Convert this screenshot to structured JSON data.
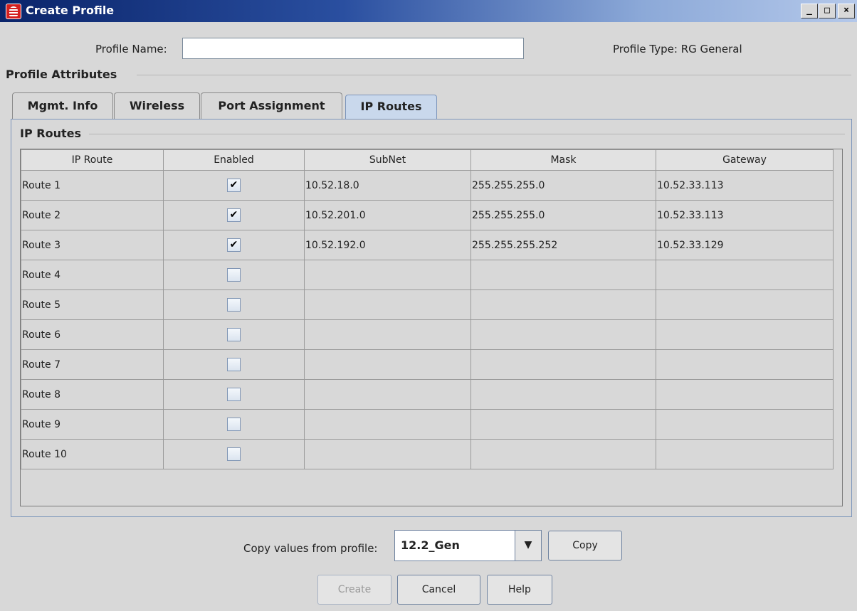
{
  "window": {
    "title": "Create Profile",
    "controls": {
      "minimize": "_",
      "maximize": "□",
      "close": "×"
    }
  },
  "profile": {
    "name_label": "Profile Name:",
    "name_value": "",
    "type_label": "Profile Type:",
    "type_value": "RG General"
  },
  "attributes": {
    "section_title": "Profile Attributes",
    "tabs": [
      {
        "label": "Mgmt. Info",
        "active": false
      },
      {
        "label": "Wireless",
        "active": false
      },
      {
        "label": "Port Assignment",
        "active": false
      },
      {
        "label": "IP Routes",
        "active": true
      }
    ]
  },
  "ip_routes": {
    "section_title": "IP Routes",
    "columns": [
      "IP Route",
      "Enabled",
      "SubNet",
      "Mask",
      "Gateway"
    ],
    "rows": [
      {
        "route": "Route 1",
        "enabled": true,
        "subnet": "10.52.18.0",
        "mask": "255.255.255.0",
        "gateway": "10.52.33.113"
      },
      {
        "route": "Route 2",
        "enabled": true,
        "subnet": "10.52.201.0",
        "mask": "255.255.255.0",
        "gateway": "10.52.33.113"
      },
      {
        "route": "Route 3",
        "enabled": true,
        "subnet": "10.52.192.0",
        "mask": "255.255.255.252",
        "gateway": "10.52.33.129"
      },
      {
        "route": "Route 4",
        "enabled": false,
        "subnet": "",
        "mask": "",
        "gateway": ""
      },
      {
        "route": "Route 5",
        "enabled": false,
        "subnet": "",
        "mask": "",
        "gateway": ""
      },
      {
        "route": "Route 6",
        "enabled": false,
        "subnet": "",
        "mask": "",
        "gateway": ""
      },
      {
        "route": "Route 7",
        "enabled": false,
        "subnet": "",
        "mask": "",
        "gateway": ""
      },
      {
        "route": "Route 8",
        "enabled": false,
        "subnet": "",
        "mask": "",
        "gateway": ""
      },
      {
        "route": "Route 9",
        "enabled": false,
        "subnet": "",
        "mask": "",
        "gateway": ""
      },
      {
        "route": "Route 10",
        "enabled": false,
        "subnet": "",
        "mask": "",
        "gateway": ""
      }
    ]
  },
  "copy": {
    "label": "Copy values from profile:",
    "selected": "12.2_Gen",
    "button": "Copy"
  },
  "actions": {
    "create": "Create",
    "create_enabled": false,
    "cancel": "Cancel",
    "help": "Help"
  },
  "icons": {
    "app": "app-logo-icon",
    "dropdown": "chevron-down-icon",
    "checkmark": "check-icon"
  }
}
